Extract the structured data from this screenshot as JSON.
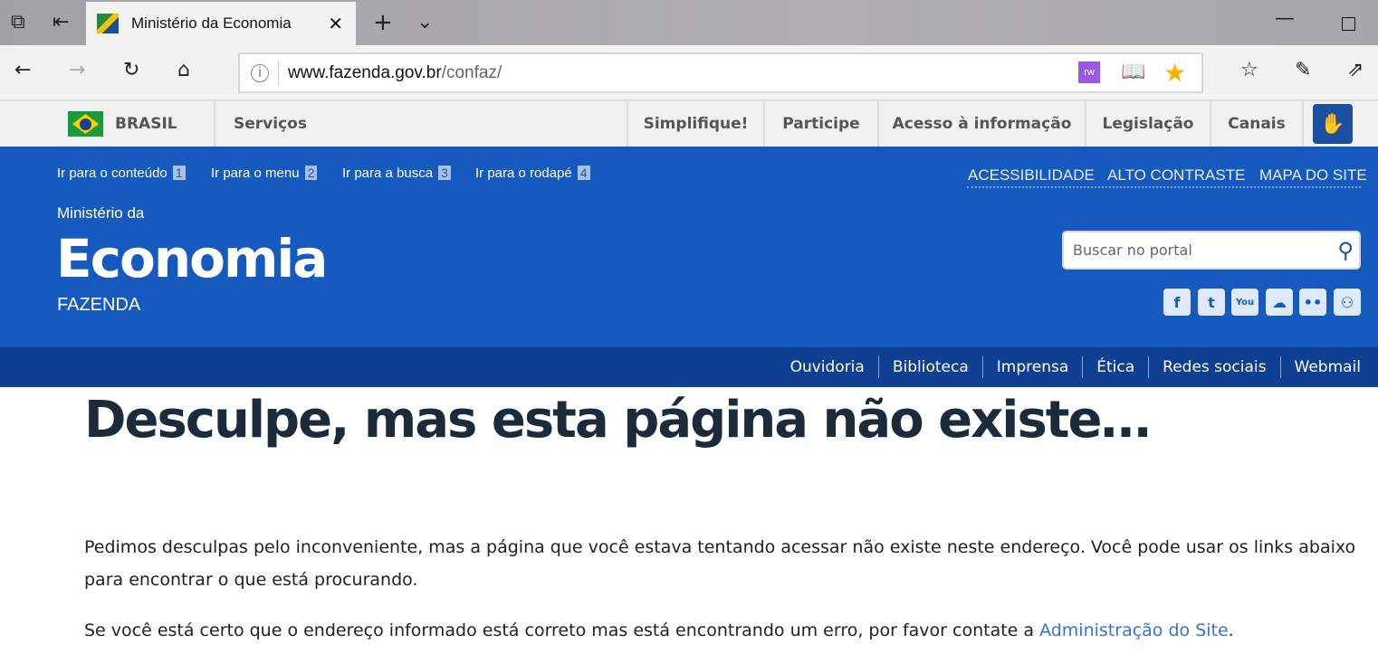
{
  "browser": {
    "tab_title": "Ministério da Economia",
    "url_host": "www.fazenda.gov.br",
    "url_path": "/confaz/"
  },
  "govbar": {
    "brasil": "BRASIL",
    "servicos": "Serviços",
    "items": [
      "Simplifique!",
      "Participe",
      "Acesso à informação",
      "Legislação",
      "Canais"
    ]
  },
  "header": {
    "skip_links": [
      {
        "label": "Ir para o conteúdo",
        "key": "1"
      },
      {
        "label": "Ir para o menu",
        "key": "2"
      },
      {
        "label": "Ir para a busca",
        "key": "3"
      },
      {
        "label": "Ir para o rodapé",
        "key": "4"
      }
    ],
    "top_links": [
      "ACESSIBILIDADE",
      "ALTO CONTRASTE",
      "MAPA DO SITE"
    ],
    "pre_title": "Ministério da",
    "title": "Economia",
    "subtitle": "FAZENDA",
    "search_placeholder": "Buscar no portal",
    "social": [
      "facebook-icon",
      "twitter-icon",
      "youtube-icon",
      "soundcloud-icon",
      "flickr-icon",
      "slideshare-icon"
    ]
  },
  "subnav": [
    "Ouvidoria",
    "Biblioteca",
    "Imprensa",
    "Ética",
    "Redes sociais",
    "Webmail"
  ],
  "content": {
    "heading": "Desculpe, mas esta página não existe…",
    "p1": "Pedimos desculpas pelo inconveniente, mas a página que você estava tentando acessar não existe neste endereço. Você pode usar os links abaixo para encontrar o que está procurando.",
    "p2_prefix": "Se você está certo que o endereço informado está correto mas está encontrando um erro, por favor contate a ",
    "p2_link": "Administração do Site",
    "p2_suffix": "."
  },
  "colors": {
    "header_blue": "#1659bf",
    "subnav_blue": "#0f3f93",
    "link": "#3b6fd6",
    "favorite_star": "#f5b400"
  }
}
